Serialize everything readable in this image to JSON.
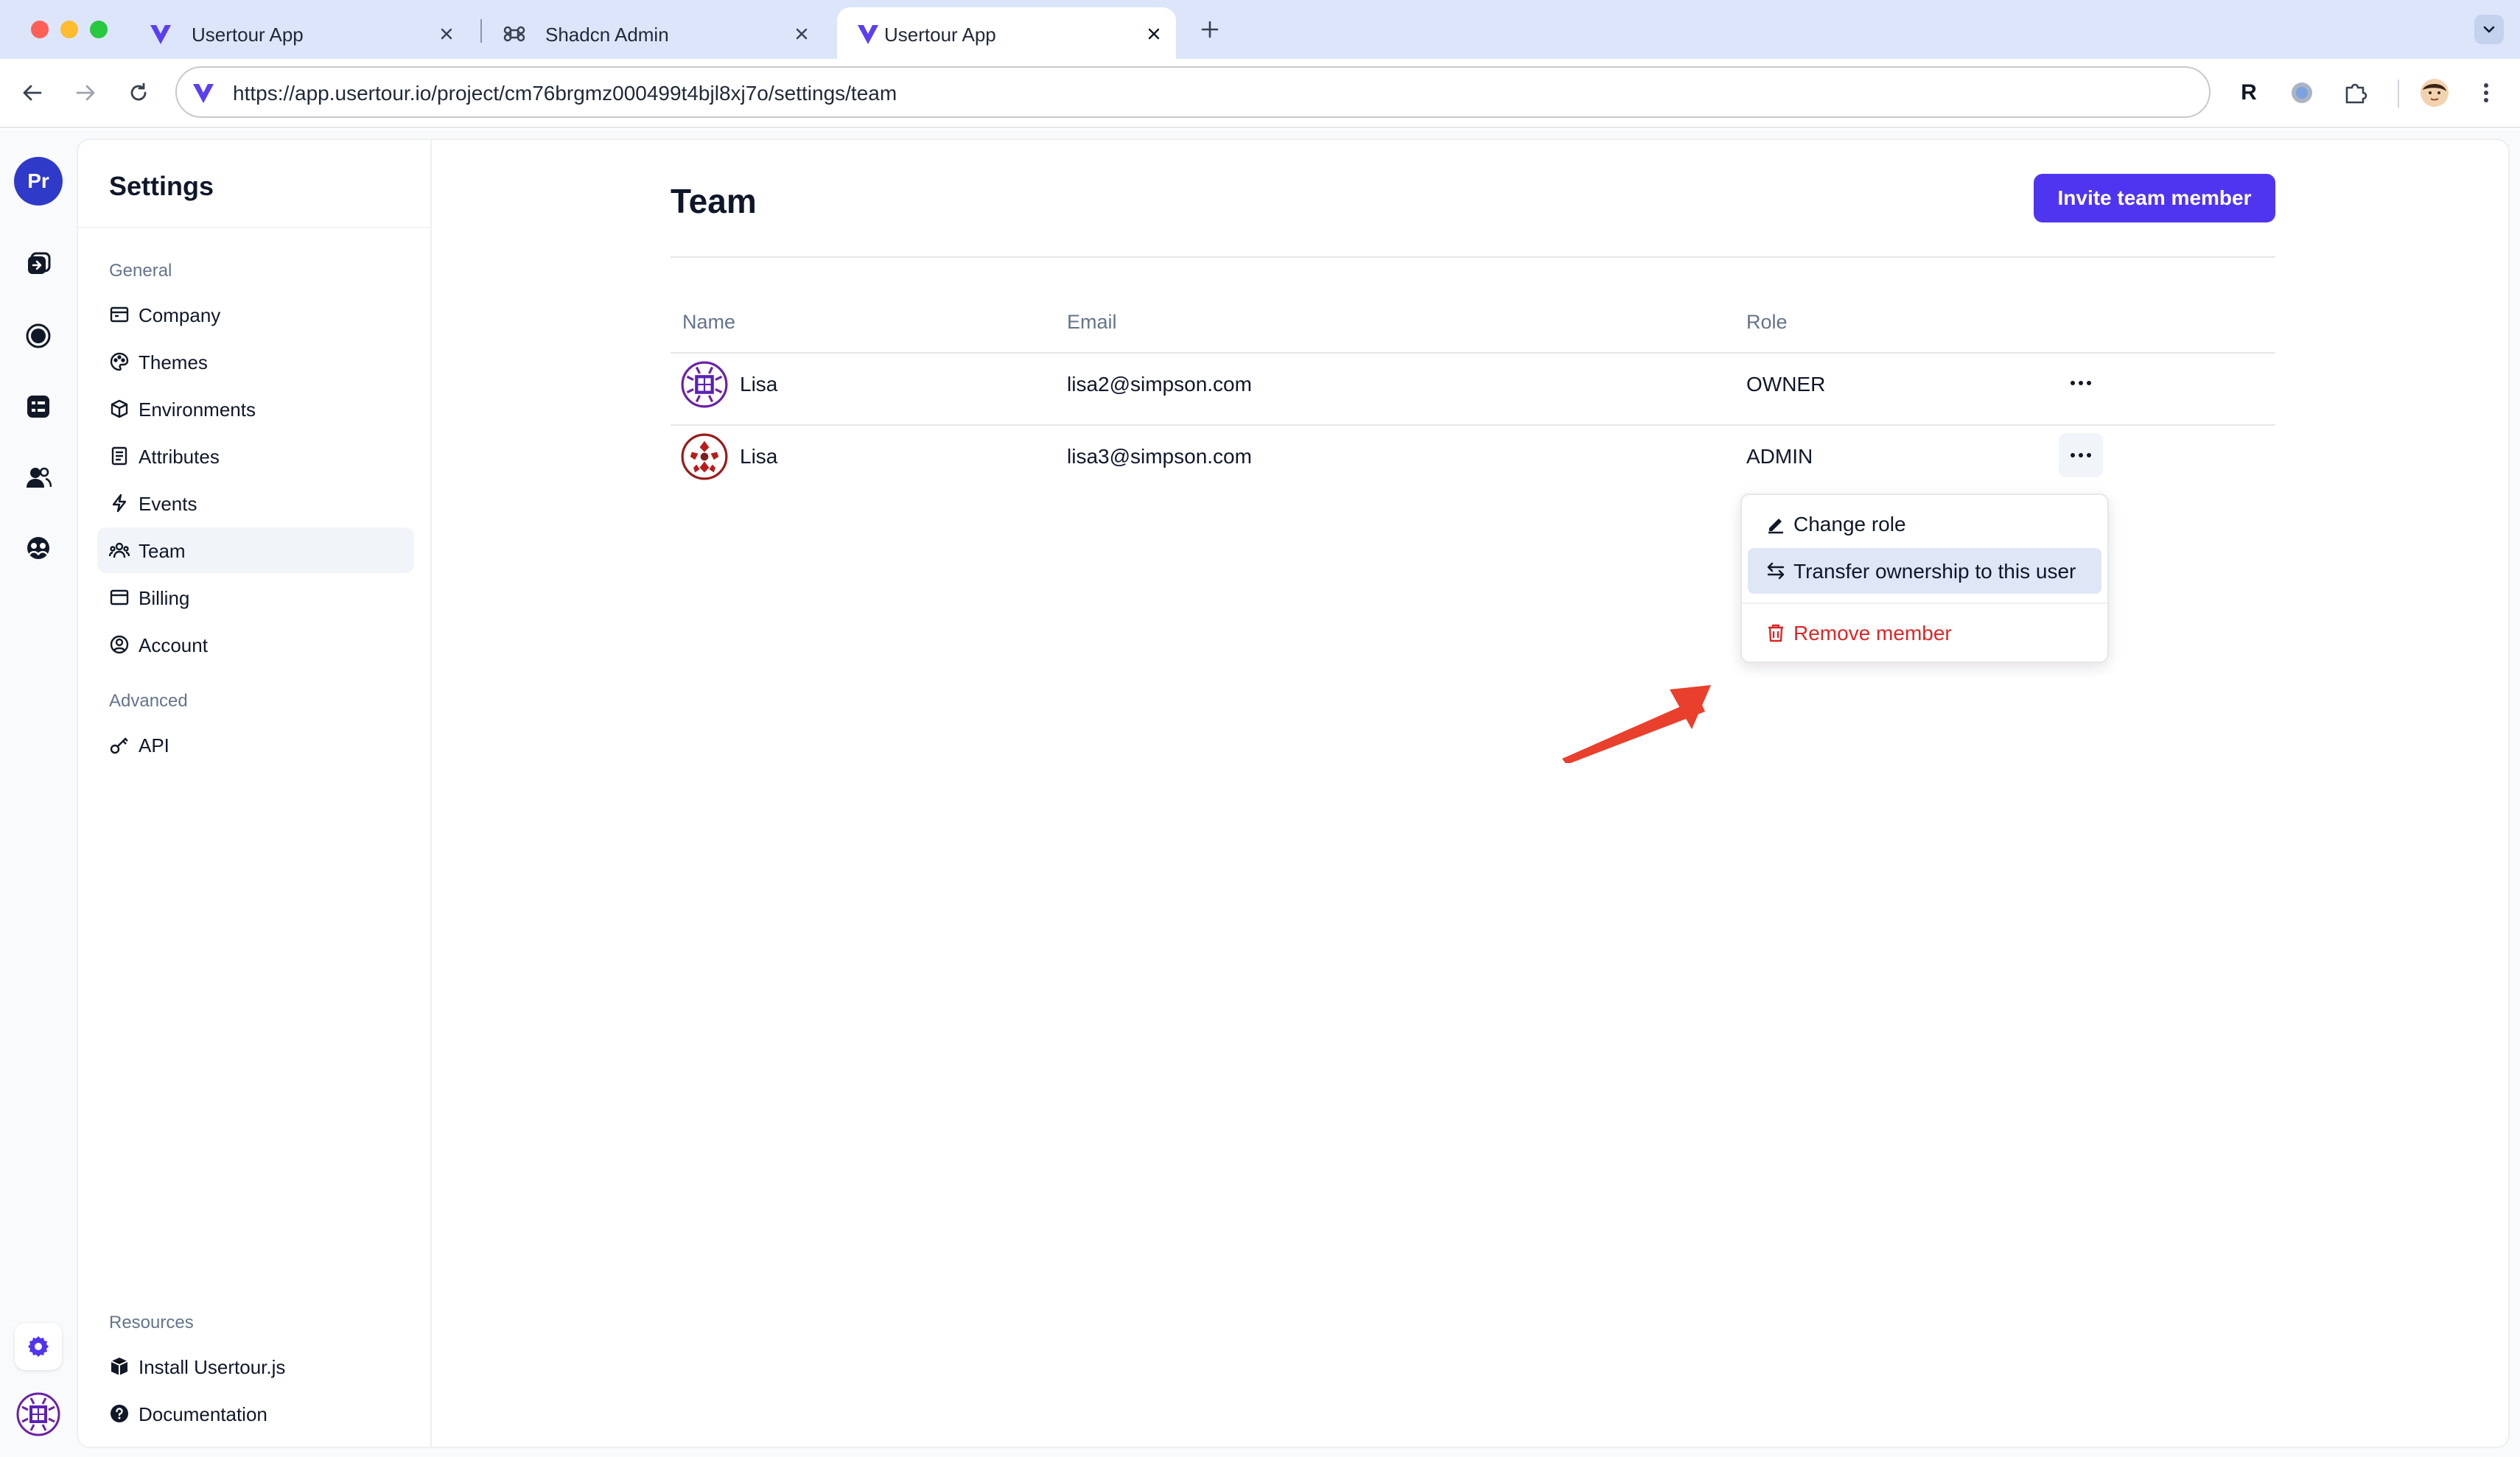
{
  "browser": {
    "tabs": [
      {
        "title": "Usertour App",
        "icon": "usertour-logo-icon"
      },
      {
        "title": "Shadcn Admin",
        "icon": "command-icon"
      },
      {
        "title": "Usertour App",
        "icon": "usertour-logo-icon",
        "active": true
      }
    ],
    "url": "https://app.usertour.io/project/cm76brgmz000499t4bjl8xj7o/settings/team",
    "extension_r_label": "R"
  },
  "rail": {
    "project_initials": "Pr",
    "icons": [
      "flows-icon",
      "launchers-icon",
      "checklists-icon",
      "users-icon",
      "companies-icon",
      "settings-icon"
    ]
  },
  "settings_nav": {
    "title": "Settings",
    "general_label": "General",
    "general_items": [
      {
        "label": "Company",
        "icon": "company-icon"
      },
      {
        "label": "Themes",
        "icon": "palette-icon"
      },
      {
        "label": "Environments",
        "icon": "box-icon"
      },
      {
        "label": "Attributes",
        "icon": "list-icon"
      },
      {
        "label": "Events",
        "icon": "bolt-icon"
      },
      {
        "label": "Team",
        "icon": "team-icon",
        "active": true
      },
      {
        "label": "Billing",
        "icon": "card-icon"
      },
      {
        "label": "Account",
        "icon": "user-circle-icon"
      }
    ],
    "advanced_label": "Advanced",
    "advanced_items": [
      {
        "label": "API",
        "icon": "key-icon"
      }
    ],
    "resources_label": "Resources",
    "resources_items": [
      {
        "label": "Install Usertour.js",
        "icon": "package-icon"
      },
      {
        "label": "Documentation",
        "icon": "help-icon"
      }
    ]
  },
  "team": {
    "title": "Team",
    "invite_button": "Invite team member",
    "columns": {
      "name": "Name",
      "email": "Email",
      "role": "Role"
    },
    "members": [
      {
        "name": "Lisa",
        "email": "lisa2@simpson.com",
        "role": "OWNER"
      },
      {
        "name": "Lisa",
        "email": "lisa3@simpson.com",
        "role": "ADMIN"
      }
    ]
  },
  "row_menu": {
    "items": [
      {
        "label": "Change role",
        "icon": "pencil-icon"
      },
      {
        "label": "Transfer ownership to this user",
        "icon": "arrows-swap-icon",
        "highlighted": true
      },
      {
        "label": "Remove member",
        "icon": "trash-icon",
        "danger": true
      }
    ]
  },
  "colors": {
    "accent": "#4f35f0",
    "danger": "#dc2626",
    "annotation_arrow": "#e8402c"
  }
}
